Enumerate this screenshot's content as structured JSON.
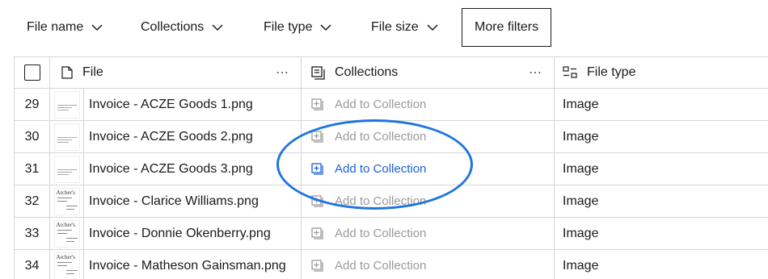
{
  "filters": {
    "file_name": "File name",
    "collections": "Collections",
    "file_type": "File type",
    "file_size": "File size",
    "more": "More filters"
  },
  "headers": {
    "file": "File",
    "collections": "Collections",
    "file_type": "File type",
    "menu": "⋯"
  },
  "rows": [
    {
      "num": "29",
      "name": "Invoice - ACZE Goods 1.png",
      "collection": "Add to Collection",
      "type": "Image",
      "thumb": "plain"
    },
    {
      "num": "30",
      "name": "Invoice - ACZE Goods 2.png",
      "collection": "Add to Collection",
      "type": "Image",
      "thumb": "plain"
    },
    {
      "num": "31",
      "name": "Invoice - ACZE Goods 3.png",
      "collection": "Add to Collection",
      "type": "Image",
      "thumb": "plain"
    },
    {
      "num": "32",
      "name": "Invoice - Clarice Williams.png",
      "collection": "Add to Collection",
      "type": "Image",
      "thumb": "archers"
    },
    {
      "num": "33",
      "name": "Invoice - Donnie Okenberry.png",
      "collection": "Add to Collection",
      "type": "Image",
      "thumb": "archers"
    },
    {
      "num": "34",
      "name": "Invoice - Matheson Gainsman.png",
      "collection": "Add to Collection",
      "type": "Image",
      "thumb": "archers"
    }
  ],
  "thumb_brand": "Archer's",
  "highlight": {
    "row": "31",
    "color": "#1e74e0"
  },
  "colors": {
    "active_link": "#1f5fd6",
    "muted": "#9a9a9a",
    "border": "#d6d6d6"
  }
}
